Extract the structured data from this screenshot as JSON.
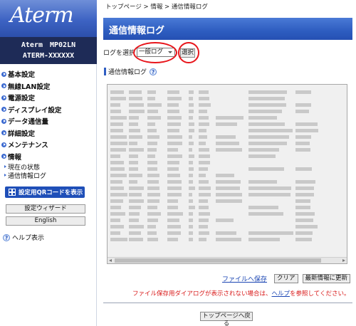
{
  "sidebar": {
    "logo": "Aterm",
    "model": "Aterm　MP02LN",
    "device": "ATERM-XXXXXX",
    "menu": [
      {
        "label": "基本設定"
      },
      {
        "label": "無線LAN設定"
      },
      {
        "label": "電源設定"
      },
      {
        "label": "ディスプレイ設定"
      },
      {
        "label": "データ通信量"
      },
      {
        "label": "詳細設定"
      },
      {
        "label": "メンテナンス"
      },
      {
        "label": "情報"
      }
    ],
    "submenu": [
      {
        "label": "現在の状態"
      },
      {
        "label": "通信情報ログ"
      }
    ],
    "qr_button": "設定用QRコードを表示",
    "wizard_button": "設定ウィザード",
    "english_button": "English",
    "help": "ヘルプ表示",
    "help_icon": "?"
  },
  "main": {
    "breadcrumb": "トップページ > 情報 > 通信情報ログ",
    "title": "通信情報ログ",
    "select_label": "ログを選択",
    "select_value": "一般ログ",
    "select_button": "選択",
    "log_label": "通信情報ログ",
    "log_help_icon": "?",
    "save_link": "ファイルへ保存",
    "clear_button": "クリア",
    "refresh_button": "最新情報に更新",
    "notice_prefix": "ファイル保存用ダイアログが表示されない場合は、",
    "notice_link": "ヘルプ",
    "notice_suffix": "を参照してください。",
    "top_button": "トップページへ戻る"
  },
  "colors": {
    "title_bar": "#2e5dc0",
    "model_box": "#1e2b57",
    "highlight_ring": "#e8151b",
    "notice_text": "#d91a1a",
    "link": "#1a45b3"
  }
}
